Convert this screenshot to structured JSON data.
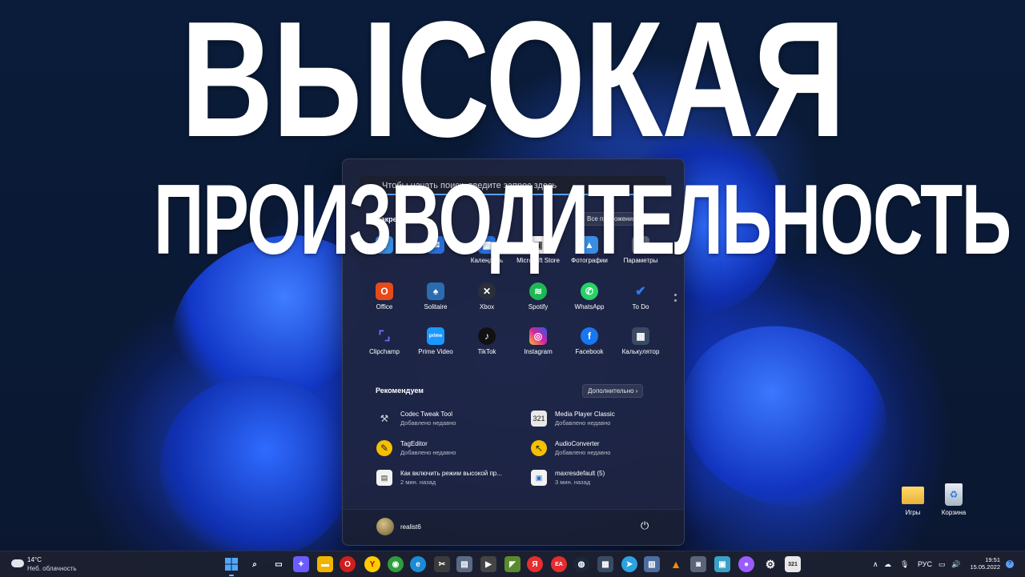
{
  "headline": {
    "line1": "ВЫСОКАЯ",
    "line2": "ПРОИЗВОДИТЕЛЬНОСТЬ"
  },
  "start_menu": {
    "search_placeholder": "Чтобы начать поиск, введите запрос здесь",
    "pinned_title": "Закреплённые",
    "all_apps_label": "Все приложения",
    "pinned_row1": [
      "",
      "Календарь",
      "Microsoft Store",
      "Фотографии",
      "Параметры"
    ],
    "apps": [
      {
        "label": "Office",
        "icon": "office-icon",
        "color": "#e64a19"
      },
      {
        "label": "Solitaire",
        "icon": "solitaire-icon",
        "color": "#2b6cb0"
      },
      {
        "label": "Xbox",
        "icon": "xbox-icon",
        "color": "#2a2f3a"
      },
      {
        "label": "Spotify",
        "icon": "spotify-icon",
        "color": "#1db954"
      },
      {
        "label": "WhatsApp",
        "icon": "whatsapp-icon",
        "color": "#25d366"
      },
      {
        "label": "To Do",
        "icon": "todo-icon",
        "color": "#2f7cf6"
      },
      {
        "label": "Clipchamp",
        "icon": "clipchamp-icon",
        "color": "#5a4bd6"
      },
      {
        "label": "Prime Video",
        "icon": "prime-video-icon",
        "color": "#1a98ff"
      },
      {
        "label": "TikTok",
        "icon": "tiktok-icon",
        "color": "#111111"
      },
      {
        "label": "Instagram",
        "icon": "instagram-icon",
        "color": "#d6249f"
      },
      {
        "label": "Facebook",
        "icon": "facebook-icon",
        "color": "#1877f2"
      },
      {
        "label": "Калькулятор",
        "icon": "calculator-icon",
        "color": "#3a4a63"
      }
    ],
    "recommended_title": "Рекомендуем",
    "more_label": "Дополнительно",
    "recommended": [
      {
        "name": "Codec Tweak Tool",
        "time": "Добавлено недавно",
        "icon": "tools-icon"
      },
      {
        "name": "Media Player Classic",
        "time": "Добавлено недавно",
        "icon": "media-player-icon"
      },
      {
        "name": "TagEditor",
        "time": "Добавлено недавно",
        "icon": "tageditor-icon"
      },
      {
        "name": "AudioConverter",
        "time": "Добавлено недавно",
        "icon": "audioconverter-icon"
      },
      {
        "name": "Как включить режим высокой пр...",
        "time": "2 мин. назад",
        "icon": "document-icon"
      },
      {
        "name": "maxresdefault (5)",
        "time": "3 мин. назад",
        "icon": "image-file-icon"
      }
    ],
    "user_name": "realist6"
  },
  "desktop_icons": [
    {
      "label": "Игры",
      "icon": "folder-icon"
    },
    {
      "label": "Корзина",
      "icon": "recycle-bin-icon"
    }
  ],
  "taskbar": {
    "weather_temp": "14°C",
    "weather_desc": "Неб. облачность",
    "language": "РУС",
    "time": "19:51",
    "date": "15.05.2022",
    "notification_count": "?"
  }
}
